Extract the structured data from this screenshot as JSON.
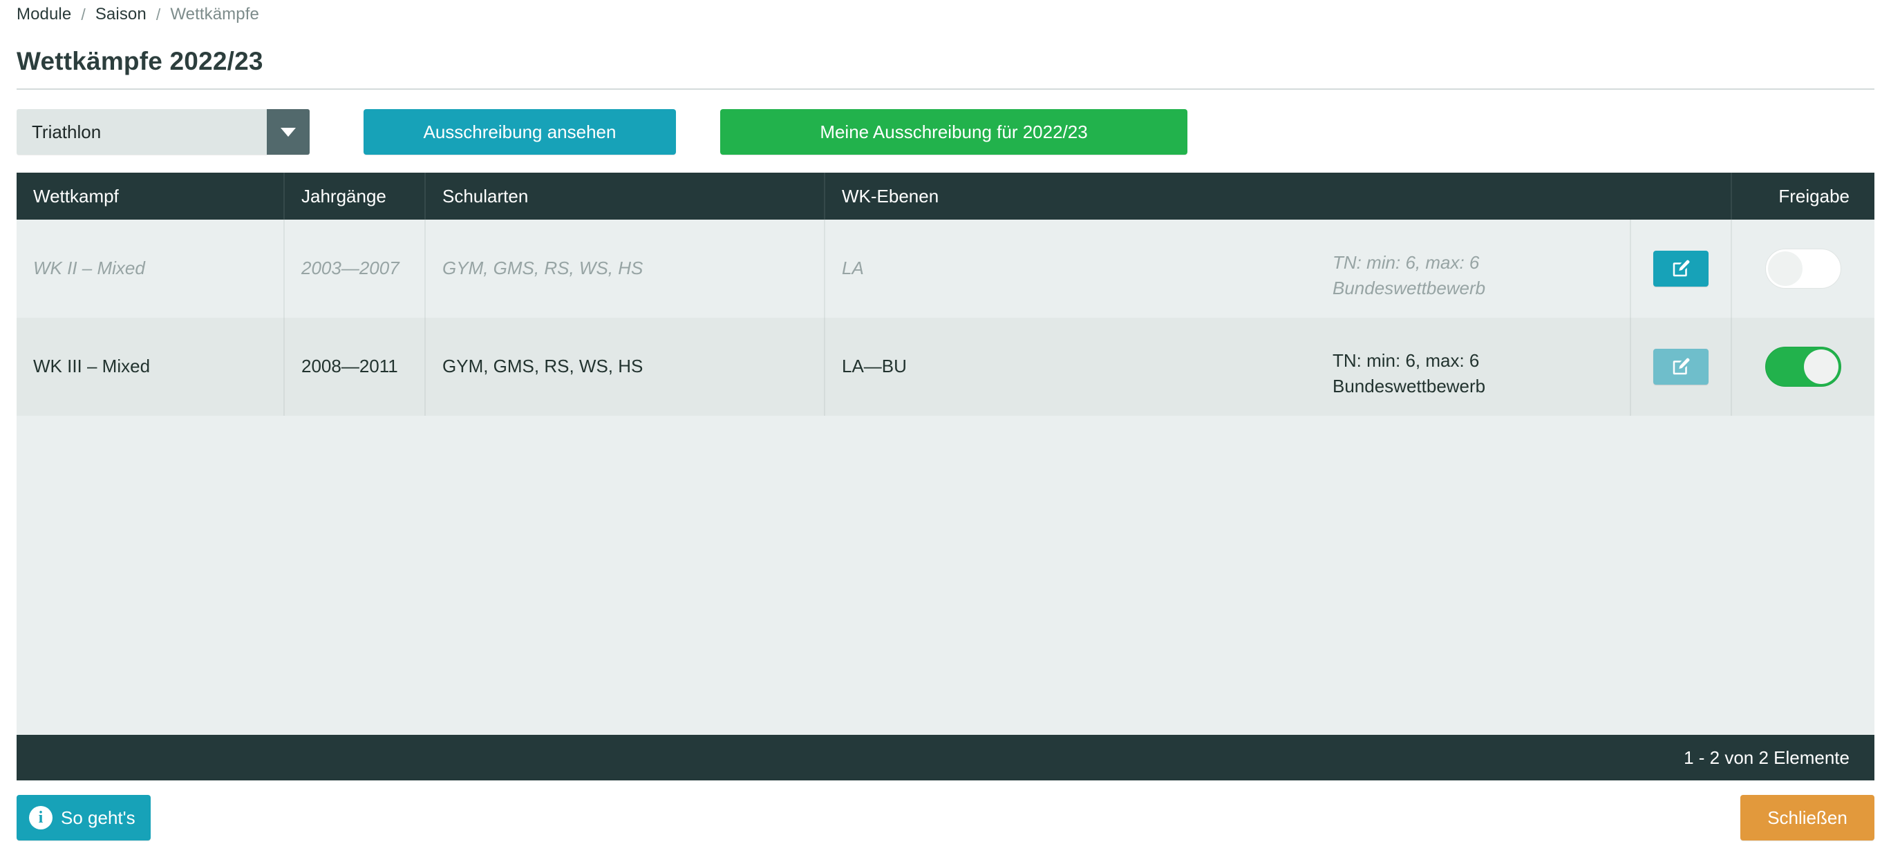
{
  "breadcrumb": {
    "items": [
      "Module",
      "Saison",
      "Wettkämpfe"
    ],
    "separator": "/"
  },
  "header": {
    "title": "Wettkämpfe 2022/23"
  },
  "toolbar": {
    "sport_select": {
      "value": "Triathlon",
      "icon": "chevron-down-icon"
    },
    "view_tender_label": "Ausschreibung ansehen",
    "my_tender_label": "Meine Ausschreibung für 2022/23"
  },
  "table": {
    "columns": [
      "Wettkampf",
      "Jahrgänge",
      "Schularten",
      "WK-Ebenen",
      "",
      "Freigabe"
    ],
    "rows": [
      {
        "wettkampf": "WK II – Mixed",
        "jahrgaenge": "2003—2007",
        "schularten": "GYM, GMS, RS, WS, HS",
        "wk_ebenen": "LA",
        "info_line1": "TN: min: 6, max: 6",
        "info_line2": "Bundeswettbewerb",
        "edit_icon": "edit-pencil-icon",
        "freigabe": "off",
        "state": "disabled"
      },
      {
        "wettkampf": "WK III – Mixed",
        "jahrgaenge": "2008—2011",
        "schularten": "GYM, GMS, RS, WS, HS",
        "wk_ebenen": "LA—BU",
        "info_line1": "TN: min: 6, max: 6",
        "info_line2": "Bundeswettbewerb",
        "edit_icon": "edit-pencil-icon",
        "freigabe": "on",
        "state": "active"
      }
    ],
    "footer_count": "1 - 2 von 2 Elemente"
  },
  "footer": {
    "help_label": "So geht's",
    "help_icon": "info-icon",
    "close_label": "Schließen"
  },
  "colors": {
    "teal": "#17a2b8",
    "green": "#22b24c",
    "orange": "#e2993c",
    "dark": "#24393a",
    "row_light": "#eaefef",
    "row_dark": "#e2e8e7"
  }
}
